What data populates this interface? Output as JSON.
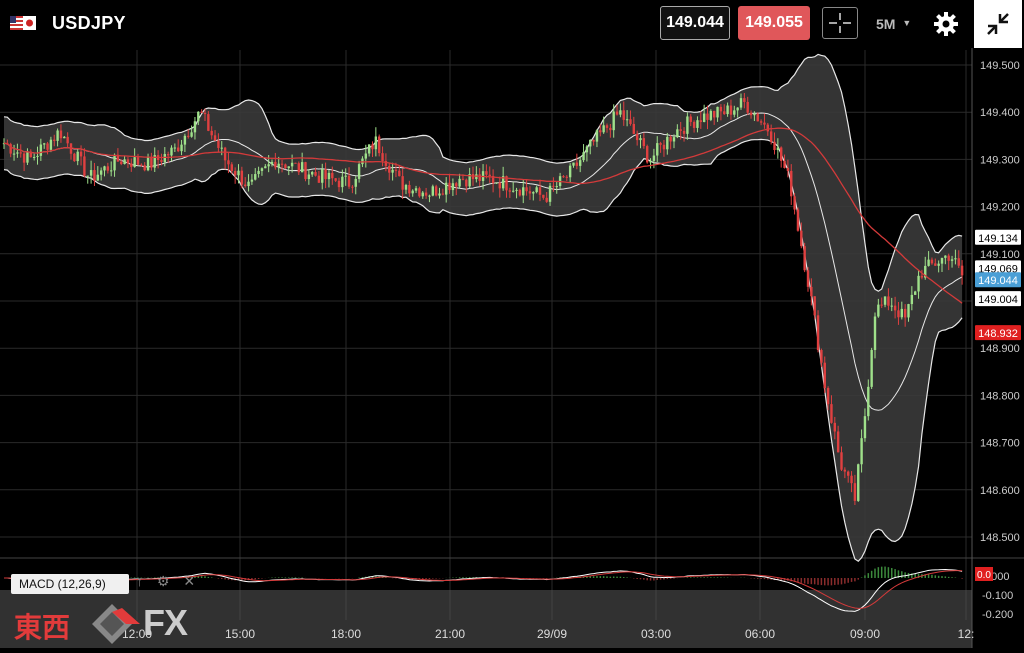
{
  "header": {
    "symbol": "USDJPY",
    "bid": "149.044",
    "ask": "149.055",
    "timeframe": "5M",
    "flag_icon": "us-jp-flag-icon",
    "crosshair_icon": "crosshair-icon",
    "settings_icon": "gear-icon",
    "shrink_icon": "collapse-icon"
  },
  "colors": {
    "ask": "#e0575a",
    "bid_label": "#4a9fd6",
    "low_label": "#e02020",
    "ma_line": "#d33a3a",
    "up_candle": "#9fe08a",
    "down_candle": "#e04040"
  },
  "price_axis": {
    "ticks": [
      "149.500",
      "149.400",
      "149.300",
      "149.200",
      "149.100",
      "149.000",
      "148.900",
      "148.800",
      "148.700",
      "148.600",
      "148.500"
    ],
    "labels": {
      "upper_band": "149.134",
      "middle_band": "149.069",
      "last_price": "149.044",
      "lower_band": "149.004",
      "ma_value": "148.932"
    }
  },
  "time_axis": {
    "ticks": [
      "12:00",
      "15:00",
      "18:00",
      "21:00",
      "29/09",
      "03:00",
      "06:00",
      "09:00",
      "12:"
    ]
  },
  "macd": {
    "label": "MACD (12,26,9)",
    "value_label": "0.0",
    "ticks": [
      "0.000",
      "-0.100",
      "-0.200"
    ],
    "tool_icons": [
      "arrow-up-icon",
      "gear-icon",
      "close-icon"
    ],
    "tool_glyphs": [
      "↑",
      "⚙",
      "✕"
    ]
  },
  "logo": {
    "cjk_text": "東西",
    "fx_text": "FX"
  },
  "chart_data": {
    "type": "candlestick",
    "instrument": "USDJPY",
    "timeframe": "5M",
    "ylim": [
      148.47,
      149.52
    ],
    "grid": true,
    "close_series_approx": [
      149.36,
      149.34,
      149.3,
      149.33,
      149.28,
      149.31,
      149.33,
      149.29,
      149.3,
      149.31,
      149.4,
      149.37,
      149.33,
      149.3,
      149.26,
      149.3,
      149.33,
      149.28,
      149.25,
      149.27,
      149.26,
      149.24,
      149.28,
      149.33,
      149.3,
      149.27,
      149.25,
      149.26,
      149.24,
      149.25,
      149.27,
      149.26,
      149.24,
      149.23,
      149.25,
      149.27,
      149.29,
      149.3,
      149.35,
      149.41,
      149.4,
      149.34,
      149.31,
      149.33,
      149.39,
      149.42,
      149.43,
      149.41,
      149.39,
      149.37,
      149.31,
      149.2,
      149.05,
      148.92,
      148.78,
      148.62,
      148.59,
      148.75,
      148.95,
      148.98,
      149.03,
      149.08,
      149.12,
      149.09,
      149.04
    ],
    "bollinger": {
      "upper_last": 149.134,
      "middle_last": 149.069,
      "lower_last": 149.004
    },
    "moving_average_last": 148.932,
    "macd_range": [
      -0.22,
      0.02
    ]
  }
}
